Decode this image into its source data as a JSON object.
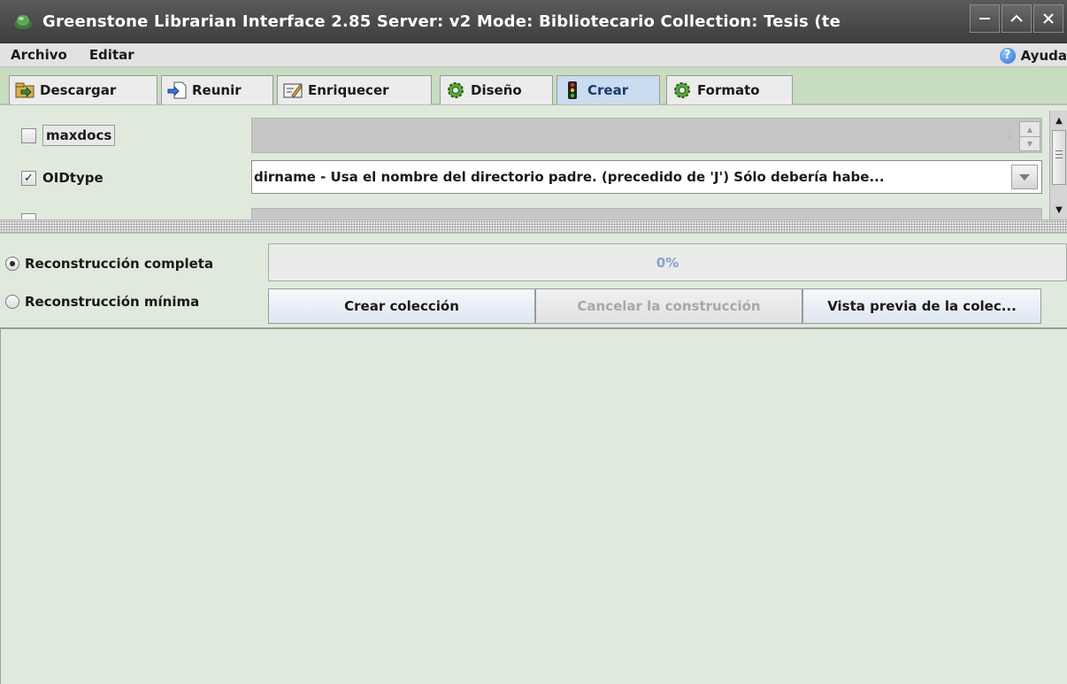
{
  "window": {
    "title": "Greenstone Librarian Interface 2.85  Server: v2  Mode: Bibliotecario  Collection: Tesis (te",
    "buttons": [
      "minimize",
      "maximize",
      "close"
    ]
  },
  "menubar": {
    "items": [
      "Archivo",
      "Editar"
    ],
    "help_label": "Ayuda",
    "help_symbol": "?"
  },
  "tabs": [
    {
      "label": "Descargar",
      "icon": "download-icon"
    },
    {
      "label": "Reunir",
      "icon": "gather-icon"
    },
    {
      "label": "Enriquecer",
      "icon": "enrich-icon"
    },
    {
      "label": "Diseño",
      "icon": "gear-icon"
    },
    {
      "label": "Crear",
      "icon": "traffic-light-icon",
      "active": true
    },
    {
      "label": "Formato",
      "icon": "gear-icon"
    }
  ],
  "options": {
    "maxdocs": {
      "label": "maxdocs",
      "checked": false,
      "value": "1"
    },
    "oidtype": {
      "label": "OIDtype",
      "checked": true,
      "check_symbol": "✓",
      "value": "dirname - Usa el nombre del directorio padre. (precedido de 'J') Sólo debería habe..."
    }
  },
  "build": {
    "full_rebuild_label": "Reconstrucción completa",
    "minimal_rebuild_label": "Reconstrucción mínima",
    "selected": "full",
    "progress_text": "0%",
    "progress_value": 0,
    "create_button": "Crear colección",
    "cancel_button": "Cancelar la construcción",
    "preview_button": "Vista previa de la colec..."
  },
  "colors": {
    "title_bar": "#4a4a4a",
    "panel_green": "#dfeadc",
    "tab_bar_green": "#c8dcc0",
    "active_tab": "#c9dcf0",
    "progress_text": "#8aa0c8"
  }
}
